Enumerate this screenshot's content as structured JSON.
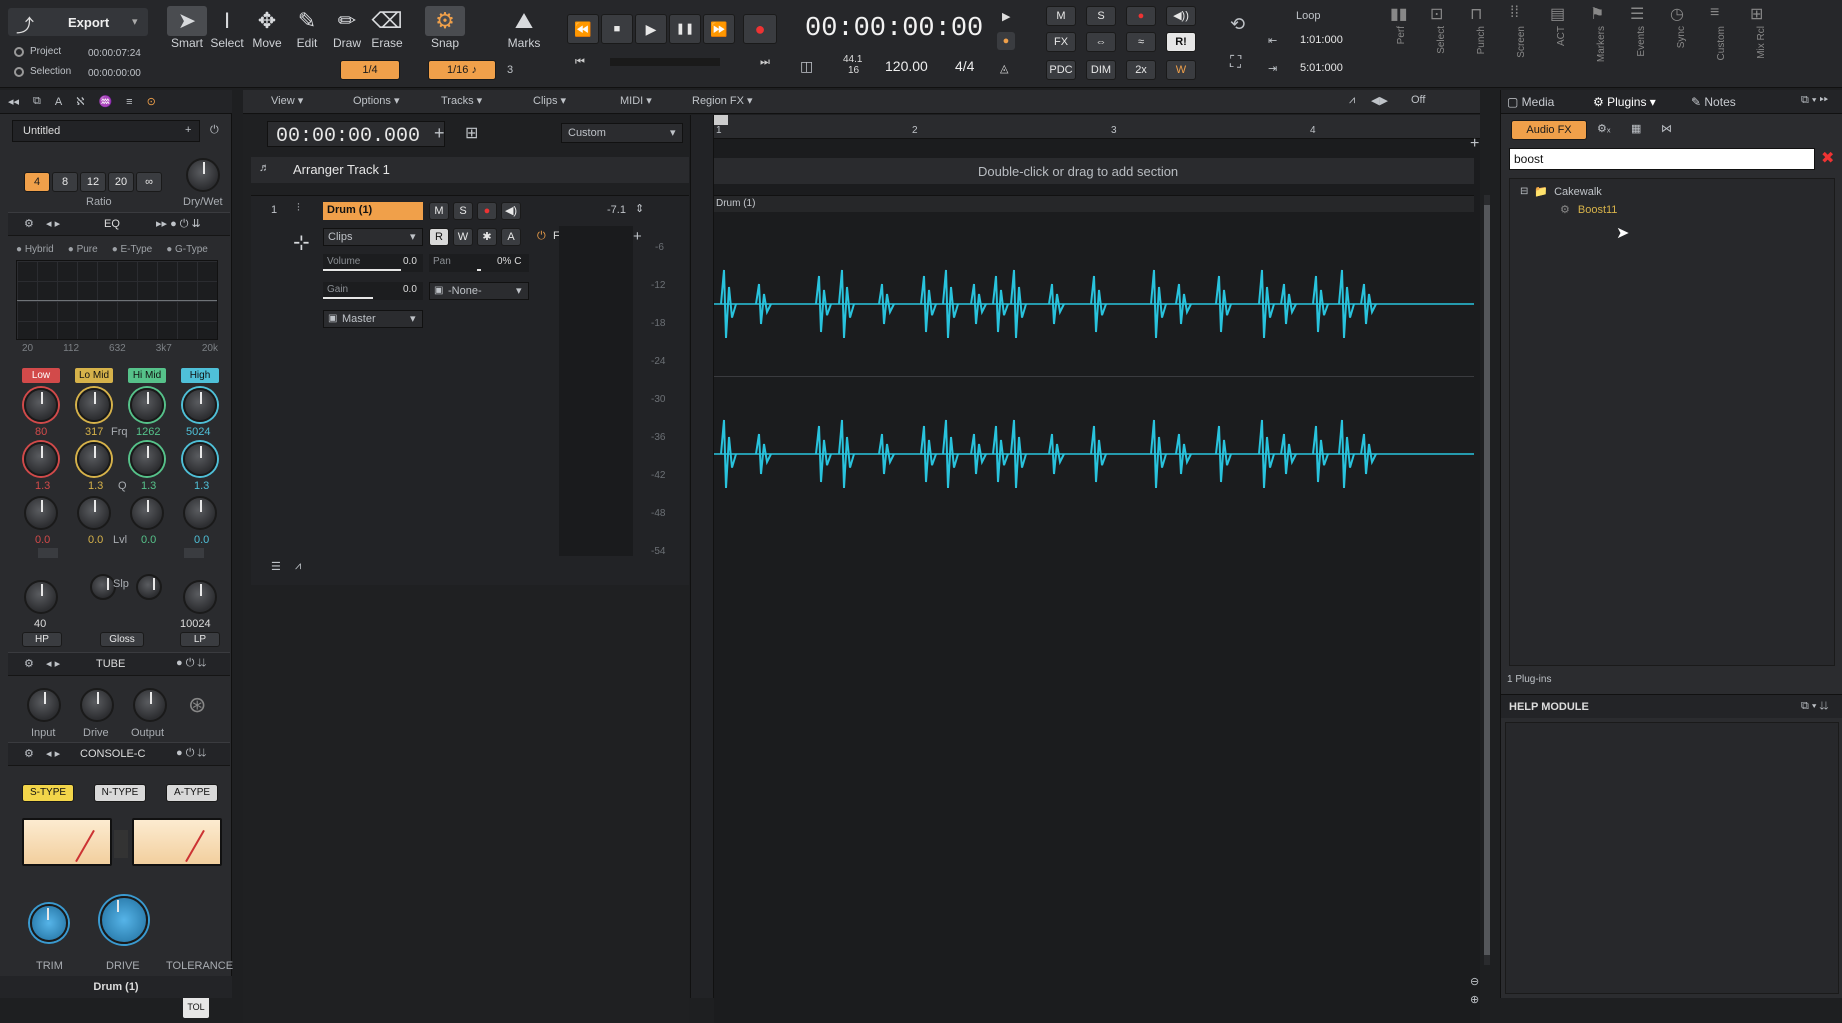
{
  "control_bar": {
    "export_label": "Export",
    "project_label": "Project",
    "project_time": "00:00:07:24",
    "selection_label": "Selection",
    "selection_time": "00:00:00:00",
    "tools": [
      "Smart",
      "Select",
      "Move",
      "Edit",
      "Draw",
      "Erase"
    ],
    "snap_label": "Snap",
    "marks_label": "Marks",
    "snap_value": "1/4",
    "grid_value": "1/16",
    "grid_num": "3",
    "now_time": "00:00:00:00",
    "sample_rate": "44.1",
    "bit_depth": "16",
    "tempo": "120.00",
    "meter": "4/4",
    "mix_m": "M",
    "mix_s": "S",
    "mix_fx": "FX",
    "mix_pdc": "PDC",
    "mix_dim": "DIM",
    "mix_2x": "2x",
    "mix_w": "W",
    "mix_ri": "R!",
    "loop_label": "Loop",
    "loop_start": "1:01:000",
    "loop_end": "5:01:000",
    "modules": [
      "Perf",
      "Select",
      "Punch",
      "Screen",
      "ACT",
      "Markers",
      "Events",
      "Sync",
      "Custom",
      "Mix Rcl"
    ]
  },
  "inspector": {
    "track_name": "Untitled",
    "ratio_buttons": [
      "4",
      "8",
      "12",
      "20",
      "∞"
    ],
    "ratio_label": "Ratio",
    "drywet_label": "Dry/Wet",
    "eq_label": "EQ",
    "eq_modes": [
      "Hybrid",
      "Pure",
      "E-Type",
      "G-Type"
    ],
    "eq_freq_axis": [
      "20",
      "112",
      "632",
      "3k7",
      "20k"
    ],
    "bands": [
      "Low",
      "Lo Mid",
      "Hi Mid",
      "High"
    ],
    "freq_values": [
      "80",
      "317",
      "1262",
      "5024"
    ],
    "frq_label": "Frq",
    "q_values": [
      "1.3",
      "1.3",
      "1.3",
      "1.3"
    ],
    "q_label": "Q",
    "lvl_values": [
      "0.0",
      "0.0",
      "0.0",
      "0.0"
    ],
    "lvl_label": "Lvl",
    "slp_label": "Slp",
    "hp_value": "40",
    "lp_value": "10024",
    "hp_label": "HP",
    "gloss_label": "Gloss",
    "lp_label": "LP",
    "tube_label": "TUBE",
    "tube_knobs": [
      "Input",
      "Drive",
      "Output"
    ],
    "console_label": "CONSOLE-C",
    "console_types": [
      "S-TYPE",
      "N-TYPE",
      "A-TYPE"
    ],
    "console_knobs": [
      "TRIM",
      "DRIVE",
      "TOLERANCE"
    ],
    "tol_label": "TOL",
    "footer_track": "Drum (1)"
  },
  "track_view": {
    "menus": [
      "View",
      "Options",
      "Tracks",
      "Clips",
      "MIDI",
      "Region FX"
    ],
    "off_label": "Off",
    "time": "00:00:00.000",
    "custom_select": "Custom",
    "arranger": "Arranger Track 1",
    "arranger_hint": "Double-click or drag to add section",
    "ruler": [
      "1",
      "2",
      "3",
      "4"
    ],
    "track": {
      "number": "1",
      "name": "Drum (1)",
      "m": "M",
      "s": "S",
      "peak": "-7.1",
      "clips_select": "Clips",
      "r": "R",
      "w": "W",
      "a": "A",
      "fx": "FX",
      "volume_label": "Volume",
      "volume_value": "0.0",
      "pan_label": "Pan",
      "pan_value": "0% C",
      "gain_label": "Gain",
      "gain_value": "0.0",
      "input": "-None-",
      "output": "Master"
    },
    "clip_name": "Drum (1)",
    "db_scale": [
      "-6",
      "-12",
      "-18",
      "-24",
      "-30",
      "-36",
      "-42",
      "-48",
      "-54"
    ],
    "waveform_color": "#29c3dd",
    "accent_color": "#f0a04a"
  },
  "browser": {
    "tabs": [
      "Media",
      "Plugins",
      "Notes"
    ],
    "audio_fx_label": "Audio FX",
    "search_value": "boost",
    "folder": "Cakewalk",
    "plugin": "Boost11",
    "count": "1 Plug-ins",
    "help_title": "HELP MODULE"
  }
}
